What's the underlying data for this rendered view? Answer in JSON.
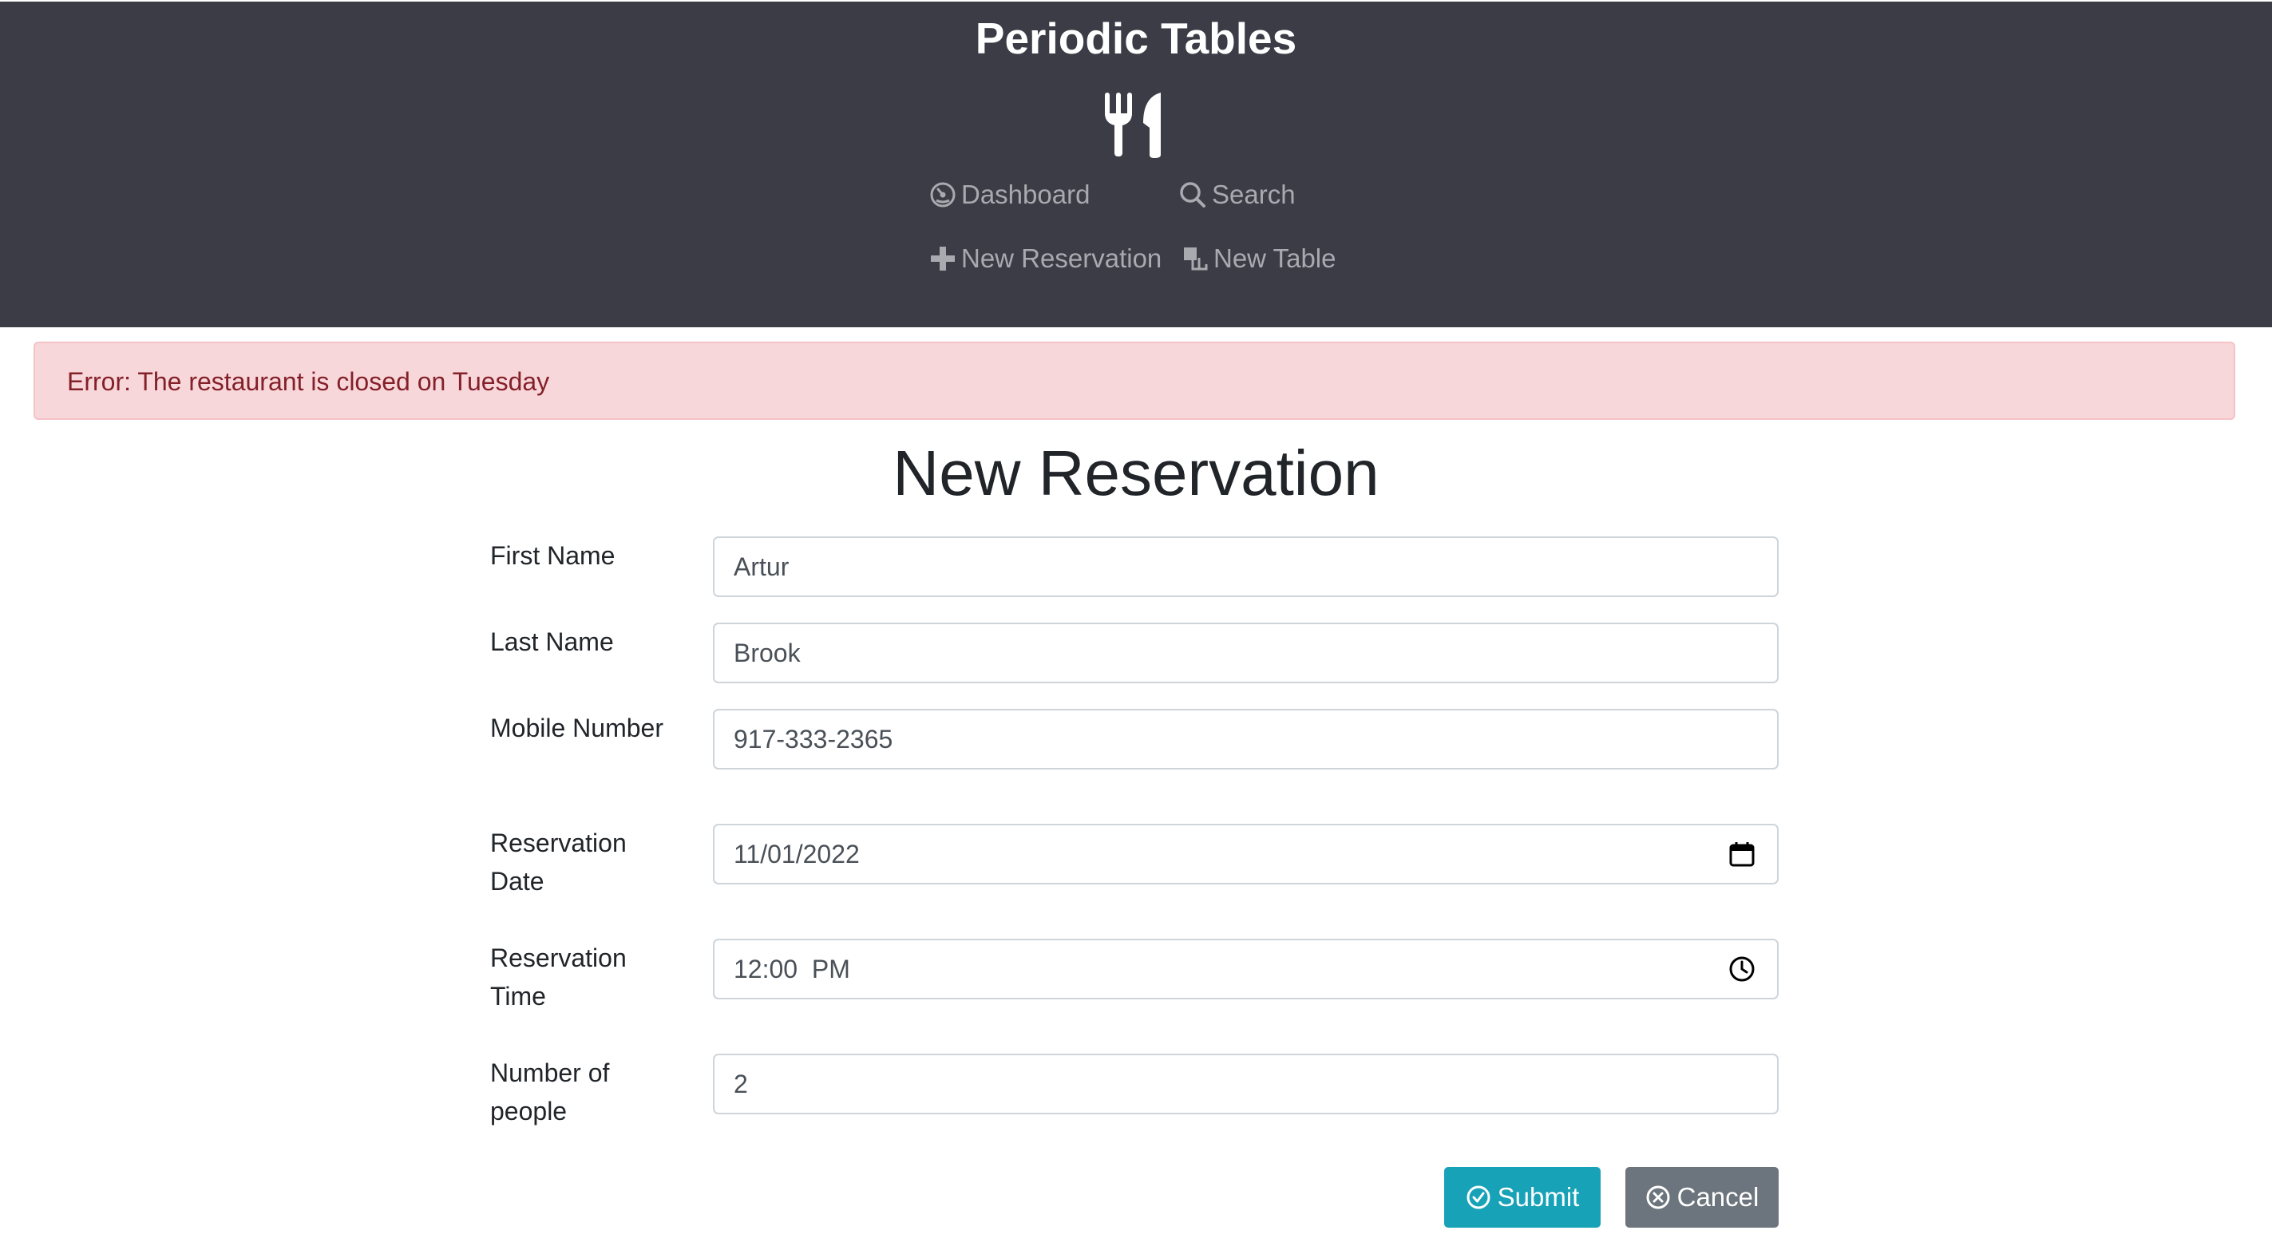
{
  "header": {
    "brand": "Periodic Tables",
    "logo_icon": "utensils-icon",
    "background": "#3b3c46",
    "nav": [
      {
        "label": "Dashboard",
        "icon": "dashboard-icon"
      },
      {
        "label": "Search",
        "icon": "search-icon"
      },
      {
        "label": "New Reservation",
        "icon": "plus-icon"
      },
      {
        "label": "New Table",
        "icon": "layers-icon"
      }
    ]
  },
  "alert": {
    "message": "Error: The restaurant is closed on Tuesday",
    "background": "#f8d7da",
    "color": "#842029"
  },
  "form": {
    "title": "New Reservation",
    "fields": [
      {
        "label": "First Name",
        "value": "Artur"
      },
      {
        "label": "Last Name",
        "value": "Brook"
      },
      {
        "label": "Mobile Number",
        "value": "917-333-2365"
      },
      {
        "label": "Reservation Date",
        "value": "11/01/2022",
        "icon": "calendar-icon"
      },
      {
        "label": "Reservation Time",
        "value": "12:00  PM",
        "icon": "clock-icon"
      },
      {
        "label": "Number of people",
        "value": "2"
      }
    ],
    "submit_label": "Submit",
    "cancel_label": "Cancel",
    "submit_color": "#17a2b8",
    "cancel_color": "#6c757d"
  }
}
